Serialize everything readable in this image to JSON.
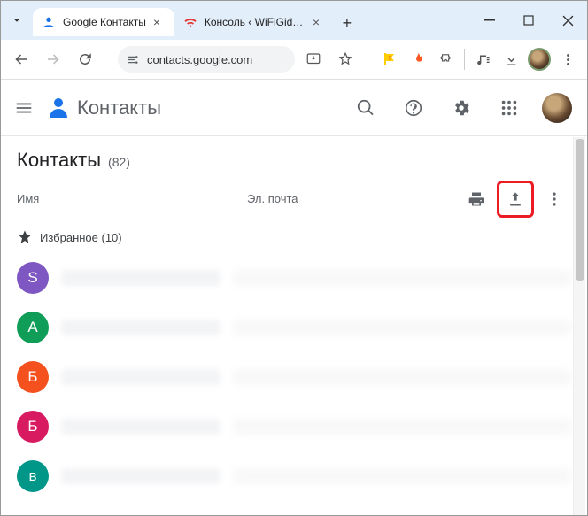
{
  "window": {
    "tabs": [
      {
        "label": "Google Контакты",
        "active": true
      },
      {
        "label": "Консоль ‹ WiFiGid — W",
        "active": false
      }
    ]
  },
  "toolbar": {
    "url": "contacts.google.com"
  },
  "app": {
    "name": "Контакты",
    "page_title": "Контакты",
    "count_label": "(82)"
  },
  "list_header": {
    "name_col": "Имя",
    "email_col": "Эл. почта"
  },
  "section": {
    "favorites_label": "Избранное (10)"
  },
  "contacts": [
    {
      "initial": "S",
      "color": "#7e57c2"
    },
    {
      "initial": "А",
      "color": "#0f9d58"
    },
    {
      "initial": "Б",
      "color": "#f4511e"
    },
    {
      "initial": "Б",
      "color": "#d81b60"
    },
    {
      "initial": "в",
      "color": "#009688"
    }
  ]
}
